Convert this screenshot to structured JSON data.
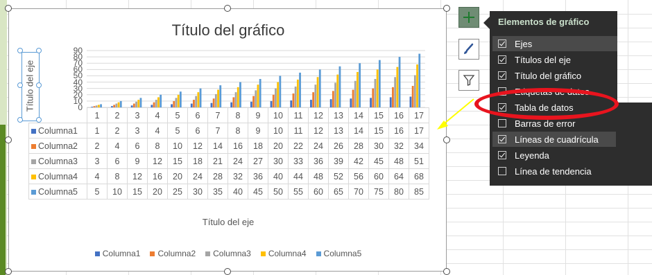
{
  "chart": {
    "title": "Título del gráfico",
    "y_axis_title": "Título del eje",
    "x_axis_title": "Título del eje"
  },
  "chart_data": {
    "type": "bar",
    "categories": [
      "1",
      "2",
      "3",
      "4",
      "5",
      "6",
      "7",
      "8",
      "9",
      "10",
      "11",
      "12",
      "13",
      "14",
      "15",
      "16",
      "17"
    ],
    "y_ticks": [
      "0",
      "10",
      "20",
      "30",
      "40",
      "50",
      "60",
      "70",
      "80",
      "90"
    ],
    "ylim": [
      0,
      90
    ],
    "grid": true,
    "legend_position": "bottom",
    "series": [
      {
        "name": "Columna1",
        "color": "#4472c4",
        "values": [
          1,
          2,
          3,
          4,
          5,
          6,
          7,
          8,
          9,
          10,
          11,
          12,
          13,
          14,
          15,
          16,
          17
        ]
      },
      {
        "name": "Columna2",
        "color": "#ed7d31",
        "values": [
          2,
          4,
          6,
          8,
          10,
          12,
          14,
          16,
          18,
          20,
          22,
          24,
          26,
          28,
          30,
          32,
          34
        ]
      },
      {
        "name": "Columna3",
        "color": "#a5a5a5",
        "values": [
          3,
          6,
          9,
          12,
          15,
          18,
          21,
          24,
          27,
          30,
          33,
          36,
          39,
          42,
          45,
          48,
          51
        ]
      },
      {
        "name": "Columna4",
        "color": "#ffc000",
        "values": [
          4,
          8,
          12,
          16,
          20,
          24,
          28,
          32,
          36,
          40,
          44,
          48,
          52,
          56,
          60,
          64,
          68
        ]
      },
      {
        "name": "Columna5",
        "color": "#5b9bd5",
        "values": [
          5,
          10,
          15,
          20,
          25,
          30,
          35,
          40,
          45,
          50,
          55,
          60,
          65,
          70,
          75,
          80,
          85
        ]
      }
    ]
  },
  "panel": {
    "title": "Elementos de gráfico",
    "options": [
      {
        "label": "Ejes",
        "checked": true
      },
      {
        "label": "Títulos del eje",
        "checked": true
      },
      {
        "label": "Título del gráfico",
        "checked": true
      },
      {
        "label": "Etiquetas de datos",
        "checked": false
      },
      {
        "label": "Tabla de datos",
        "checked": true
      },
      {
        "label": "Barras de error",
        "checked": false
      },
      {
        "label": "Líneas de cuadrícula",
        "checked": true
      },
      {
        "label": "Leyenda",
        "checked": true
      },
      {
        "label": "Línea de tendencia",
        "checked": false
      }
    ]
  },
  "colors": {
    "accent_annotation": "#e8141e",
    "arrow": "#ffff00",
    "panel_bg": "#2d2d2d"
  },
  "icons": {
    "plus": "plus-icon",
    "styles": "brush-icon",
    "filters": "filter-icon"
  }
}
